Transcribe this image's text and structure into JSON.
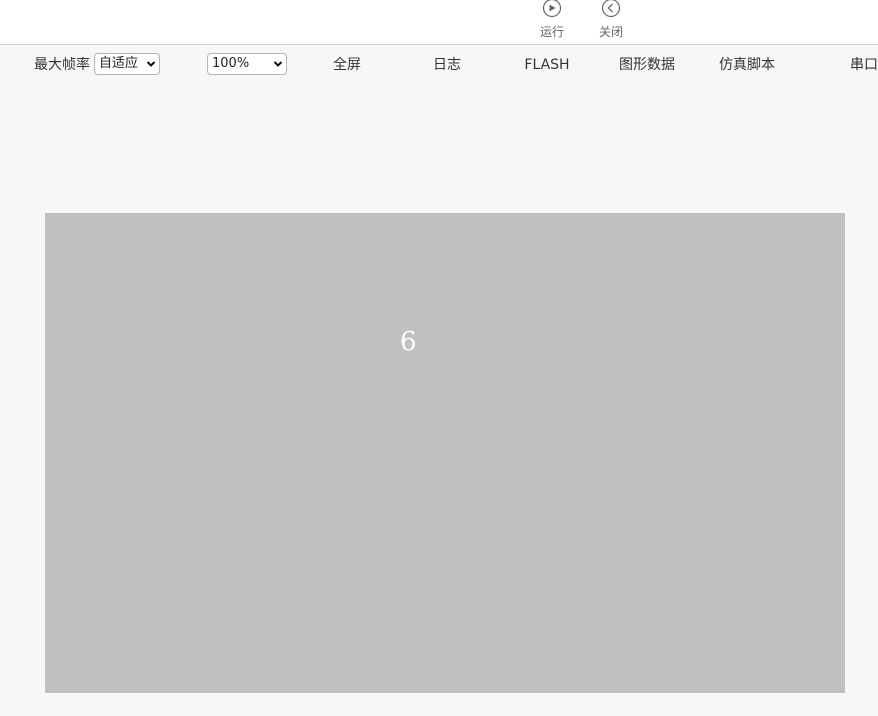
{
  "topbar": {
    "run_label": "运行",
    "close_label": "关闭",
    "run_icon": "play-circle-icon",
    "close_icon": "chevron-left-circle-icon"
  },
  "toolbar": {
    "fps_label": "最大帧率",
    "fps_value": "自适应",
    "zoom_value": "100%",
    "fullscreen": "全屏",
    "log": "日志",
    "flash": "FLASH",
    "graph_data": "图形数据",
    "sim_script": "仿真脚本",
    "serial": "串口"
  },
  "canvas": {
    "text": "6",
    "background": "#c0c0c0"
  }
}
